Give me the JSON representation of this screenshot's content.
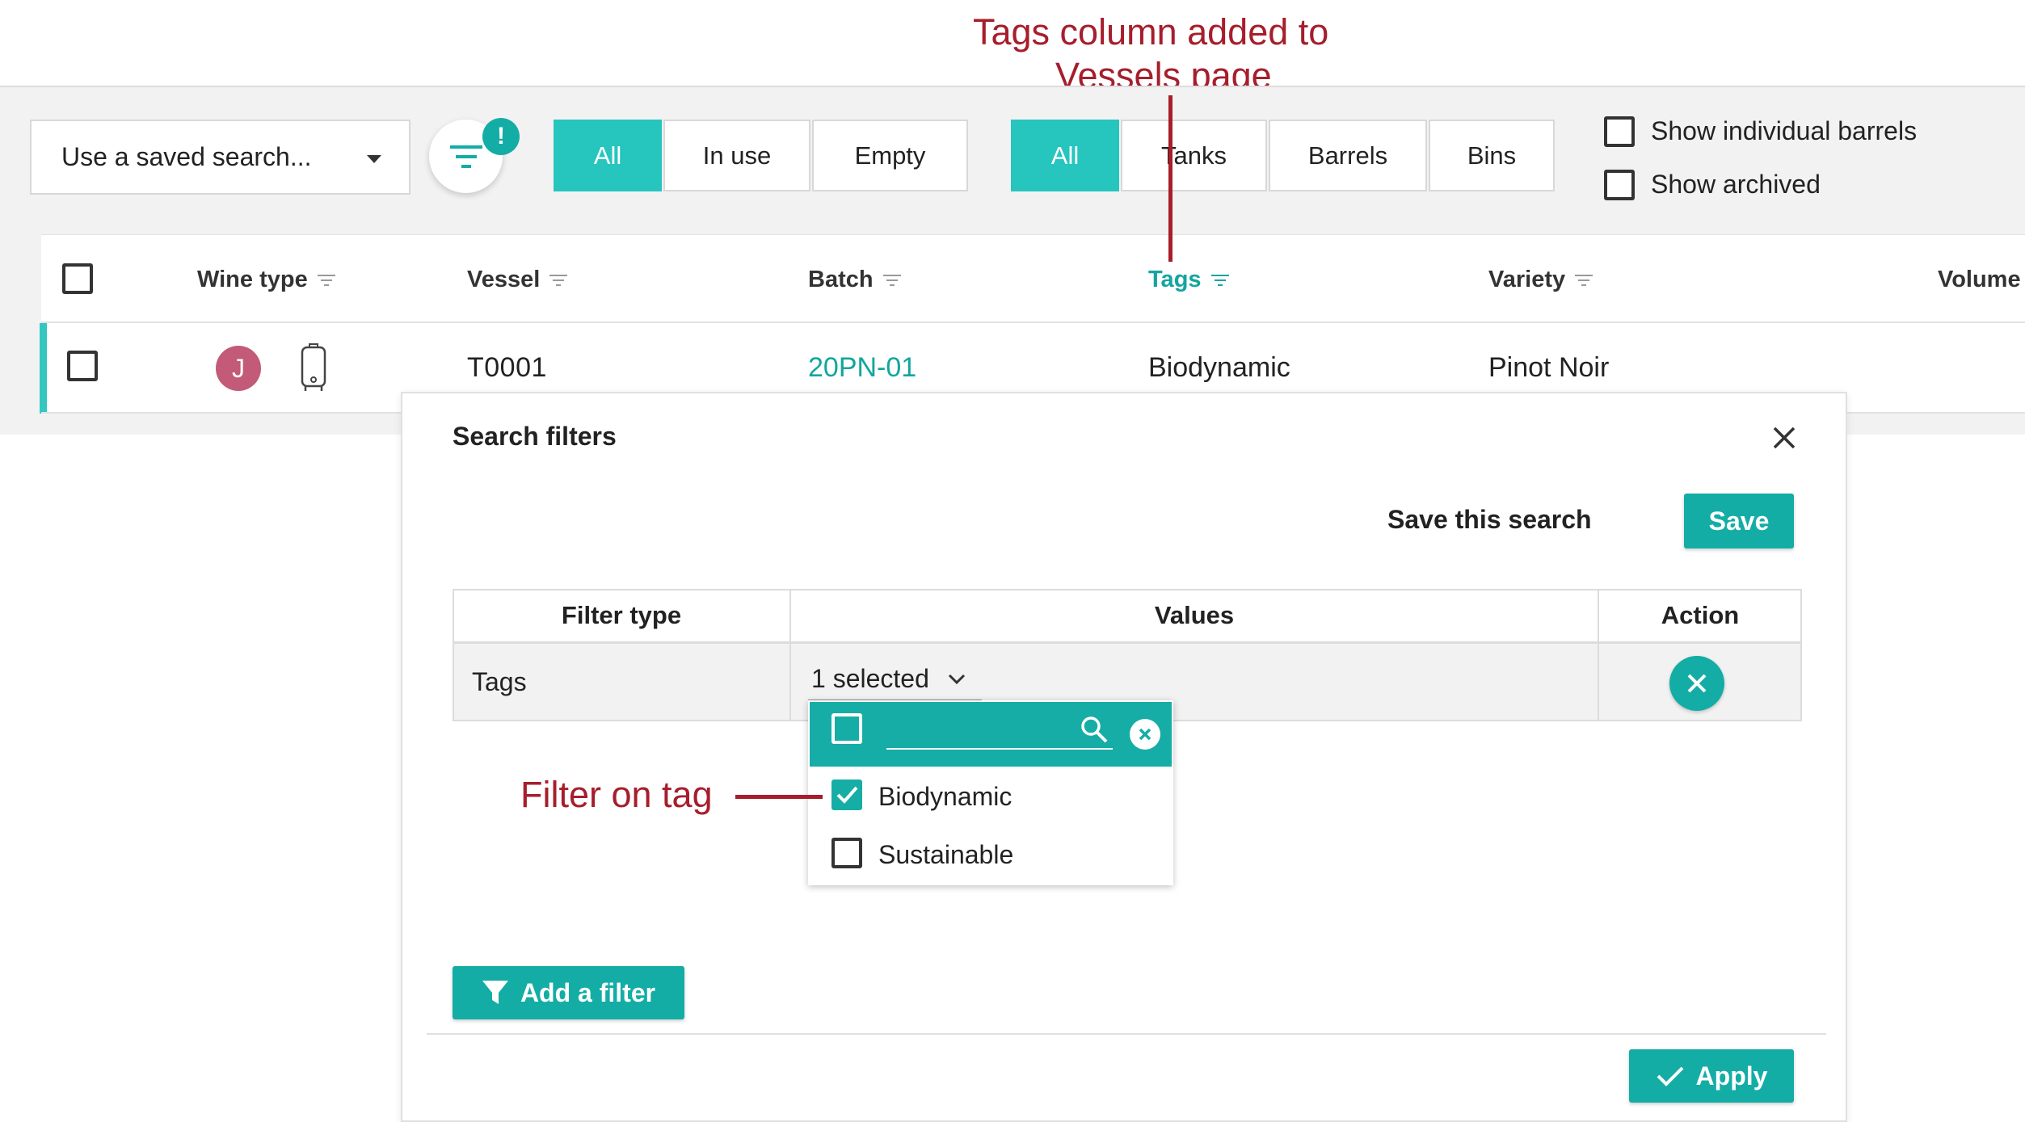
{
  "toolbar": {
    "saved_search_placeholder": "Use a saved search...",
    "filter_badge": "!",
    "status_filters": [
      {
        "label": "All",
        "active": true
      },
      {
        "label": "In use",
        "active": false
      },
      {
        "label": "Empty",
        "active": false
      }
    ],
    "type_filters": [
      {
        "label": "All",
        "active": true
      },
      {
        "label": "Tanks",
        "active": false
      },
      {
        "label": "Barrels",
        "active": false
      },
      {
        "label": "Bins",
        "active": false
      }
    ],
    "options": {
      "show_individual_barrels": "Show individual barrels",
      "show_archived": "Show archived"
    }
  },
  "table": {
    "columns": {
      "wine_type": "Wine type",
      "vessel": "Vessel",
      "batch": "Batch",
      "tags": "Tags",
      "variety": "Variety",
      "volume": "Volume"
    },
    "rows": [
      {
        "avatar_letter": "J",
        "vessel": "T0001",
        "batch": "20PN-01",
        "tags": "Biodynamic",
        "variety": "Pinot Noir"
      }
    ]
  },
  "modal": {
    "title": "Search filters",
    "save_search_label": "Save this search",
    "save_button": "Save",
    "filter_table": {
      "headers": {
        "filter_type": "Filter type",
        "values": "Values",
        "action": "Action"
      },
      "rows": [
        {
          "filter_type": "Tags",
          "values_summary": "1 selected"
        }
      ]
    },
    "dropdown": {
      "options": [
        {
          "label": "Biodynamic",
          "checked": true
        },
        {
          "label": "Sustainable",
          "checked": false
        }
      ]
    },
    "add_filter_button": "Add a filter",
    "apply_button": "Apply"
  },
  "annotations": {
    "tags_column_line1": "Tags column added to",
    "tags_column_line2": "Vessels page",
    "filter_on_tag": "Filter on tag"
  },
  "colors": {
    "accent": "#26c5be",
    "accent_dark": "#13ada6",
    "annotation": "#a61e2c",
    "avatar": "#c25a78"
  }
}
